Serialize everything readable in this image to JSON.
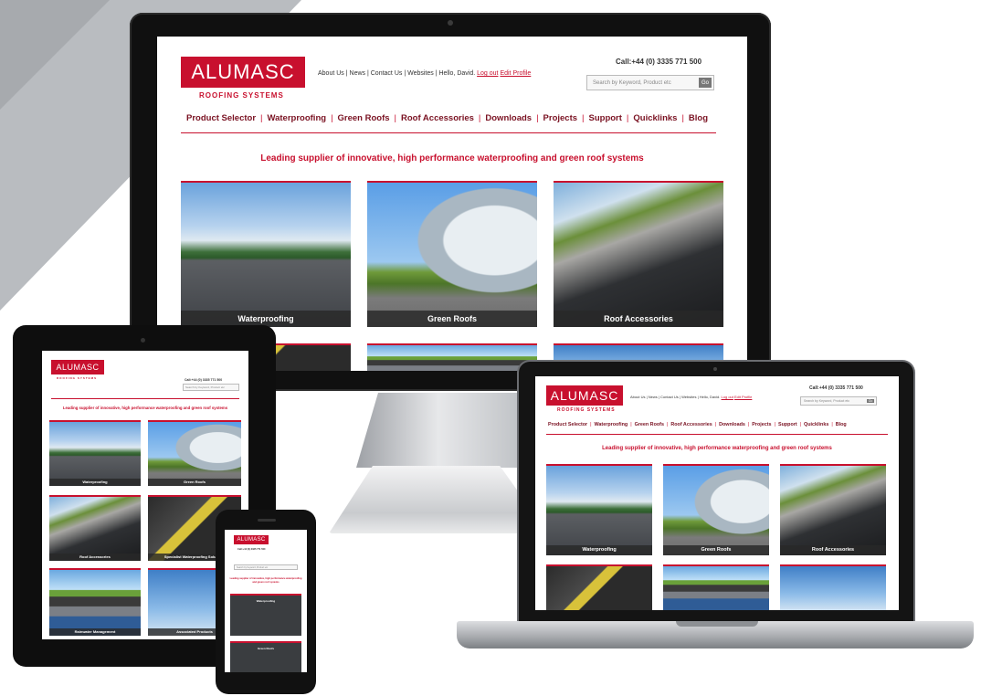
{
  "site": {
    "logo_text": "ALUMASC",
    "logo_sub": "ROOFING SYSTEMS",
    "phone": "Call:+44 (0) 3335 771 500",
    "top_links": {
      "about": "About Us",
      "news": "News",
      "contact": "Contact Us",
      "websites": "Websites",
      "hello": "Hello, David.",
      "logout": "Log out",
      "edit_profile": "Edit Profile"
    },
    "search_placeholder": "Search by Keyword, Product etc",
    "search_go": "Go",
    "nav": [
      "Product Selector",
      "Waterproofing",
      "Green Roofs",
      "Roof Accessories",
      "Downloads",
      "Projects",
      "Support",
      "Quicklinks",
      "Blog"
    ],
    "tagline": "Leading supplier of innovative, high performance waterproofing and green roof systems",
    "tiles": [
      "Waterproofing",
      "Green Roofs",
      "Roof Accessories"
    ],
    "tablet_tiles": [
      "Waterproofing",
      "Green Roofs",
      "Roof Accessories",
      "Specialist Waterproofing Solutions",
      "Rainwater Management",
      "Associated Products"
    ],
    "phone_tiles": [
      "Waterproofing",
      "Green Roofs"
    ]
  },
  "colors": {
    "brand_red": "#c8102e",
    "nav_text": "#7a1222"
  },
  "devices": [
    "desktop-monitor",
    "tablet",
    "laptop",
    "smartphone"
  ]
}
